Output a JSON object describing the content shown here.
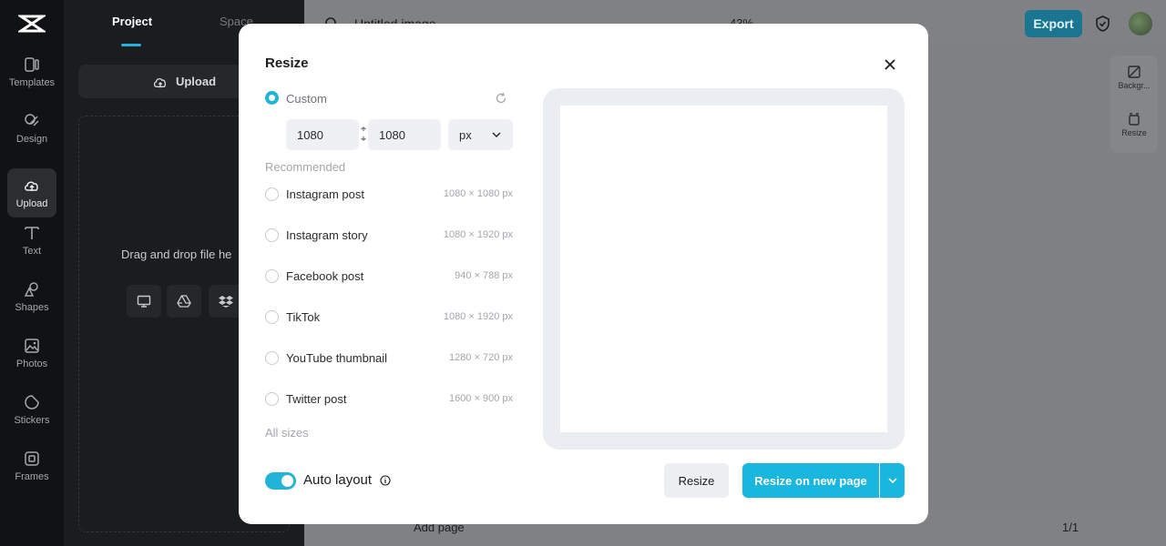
{
  "rail": {
    "items": [
      {
        "label": "Templates",
        "icon": "templates-icon"
      },
      {
        "label": "Design",
        "icon": "design-icon"
      },
      {
        "label": "Upload",
        "icon": "upload-cloud-icon"
      },
      {
        "label": "Text",
        "icon": "text-icon"
      },
      {
        "label": "Shapes",
        "icon": "shapes-icon"
      },
      {
        "label": "Photos",
        "icon": "photos-icon"
      },
      {
        "label": "Stickers",
        "icon": "stickers-icon"
      },
      {
        "label": "Frames",
        "icon": "frames-icon"
      }
    ]
  },
  "panel": {
    "tabs": [
      "Project",
      "Space"
    ],
    "upload_label": "Upload",
    "drop_text": "Drag and drop file he"
  },
  "topbar": {
    "title": "Untitled image",
    "zoom": "43%",
    "export_label": "Export"
  },
  "side_tools": {
    "background_label": "Backgr...",
    "resize_label": "Resize"
  },
  "bottombar": {
    "add_page_label": "Add page",
    "page_count": "1/1"
  },
  "modal": {
    "title": "Resize",
    "custom": {
      "label": "Custom",
      "width": "1080",
      "height": "1080",
      "unit": "px"
    },
    "recommended_label": "Recommended",
    "options": [
      {
        "label": "Instagram post",
        "size": "1080 × 1080 px"
      },
      {
        "label": "Instagram story",
        "size": "1080 × 1920 px"
      },
      {
        "label": "Facebook post",
        "size": "940 × 788 px"
      },
      {
        "label": "TikTok",
        "size": "1080 × 1920 px"
      },
      {
        "label": "YouTube thumbnail",
        "size": "1280 × 720 px"
      },
      {
        "label": "Twitter post",
        "size": "1600 × 900 px"
      }
    ],
    "all_sizes_label": "All sizes",
    "auto_layout_label": "Auto layout",
    "auto_layout_on": true,
    "resize_label": "Resize",
    "resize_new_label": "Resize on new page"
  },
  "colors": {
    "accent": "#22b4d6"
  }
}
